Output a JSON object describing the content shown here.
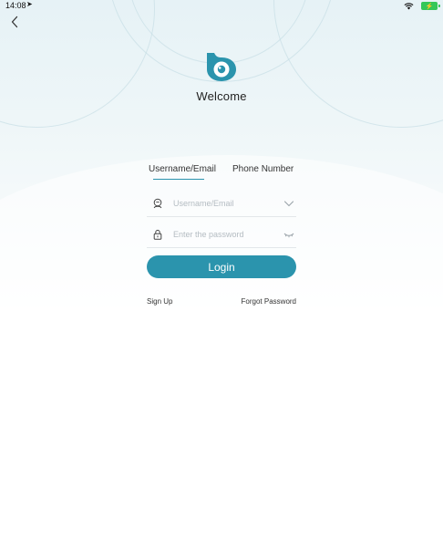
{
  "status_bar": {
    "time": "14:08",
    "location_glyph": "➤",
    "battery_label": "⚡"
  },
  "header": {
    "back_icon": "chevron-left-icon"
  },
  "brand": {
    "logo_icon": "app-logo-icon",
    "welcome": "Welcome",
    "accent_color": "#2b94ad"
  },
  "tabs": {
    "items": [
      {
        "label": "Username/Email",
        "selected": true
      },
      {
        "label": "Phone Number",
        "selected": false
      }
    ]
  },
  "form": {
    "username": {
      "value": "",
      "placeholder": "Username/Email",
      "icon": "user-icon",
      "right_icon": "chevron-down-icon"
    },
    "password": {
      "value": "",
      "placeholder": "Enter the password",
      "icon": "lock-icon",
      "right_icon": "eye-closed-icon"
    },
    "login_label": "Login"
  },
  "links": {
    "sign_up": "Sign Up",
    "forgot_password": "Forgot Password"
  }
}
